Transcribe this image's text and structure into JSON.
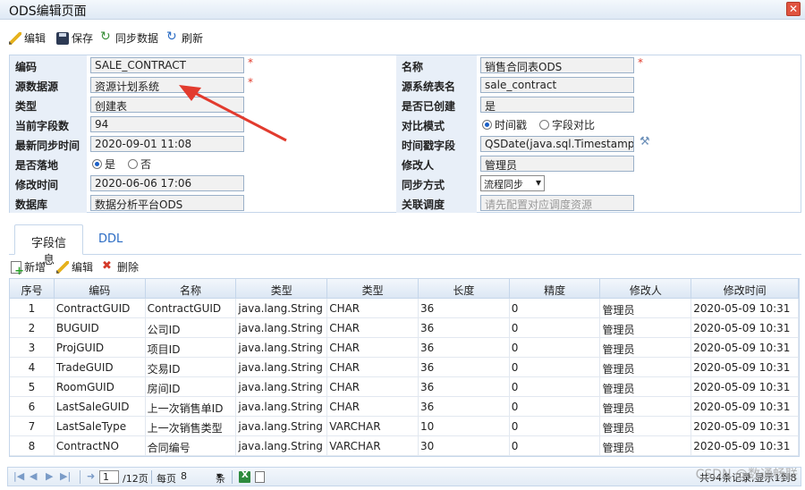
{
  "window": {
    "title": "ODS编辑页面",
    "close_glyph": "✕"
  },
  "toolbar": {
    "edit": "编辑",
    "save": "保存",
    "sync": "同步数据",
    "refresh": "刷新"
  },
  "form": {
    "code_label": "编码",
    "code_value": "SALE_CONTRACT",
    "name_label": "名称",
    "name_value": "销售合同表ODS",
    "source_label": "源数据源",
    "source_value": "资源计划系统",
    "source_table_label": "源系统表名",
    "source_table_value": "sale_contract",
    "type_label": "类型",
    "type_value": "创建表",
    "created_label": "是否已创建",
    "created_value": "是",
    "field_count_label": "当前字段数",
    "field_count_value": "94",
    "compare_label": "对比模式",
    "compare_opt1": "时间戳",
    "compare_opt2": "字段对比",
    "last_sync_label": "最新同步时间",
    "last_sync_value": "2020-09-01 11:08",
    "ts_field_label": "时间戳字段",
    "ts_field_value": "QSDate(java.sql.Timestamp)",
    "landed_label": "是否落地",
    "landed_yes": "是",
    "landed_no": "否",
    "modifier_label": "修改人",
    "modifier_value": "管理员",
    "mtime_label": "修改时间",
    "mtime_value": "2020-06-06 17:06",
    "sync_mode_label": "同步方式",
    "sync_mode_value": "流程同步",
    "db_label": "数据库",
    "db_value": "数据分析平台ODS",
    "schedule_label": "关联调度",
    "schedule_placeholder": "请先配置对应调度资源",
    "required_mark": "*"
  },
  "tabs": {
    "fields": "字段信息",
    "ddl": "DDL"
  },
  "grid_toolbar": {
    "add": "新增",
    "edit": "编辑",
    "delete": "删除"
  },
  "grid": {
    "headers": [
      "序号",
      "编码",
      "名称",
      "类型",
      "类型",
      "长度",
      "精度",
      "修改人",
      "修改时间"
    ],
    "rows": [
      [
        "1",
        "ContractGUID",
        "ContractGUID",
        "java.lang.String",
        "CHAR",
        "36",
        "0",
        "管理员",
        "2020-05-09 10:31"
      ],
      [
        "2",
        "BUGUID",
        "公司ID",
        "java.lang.String",
        "CHAR",
        "36",
        "0",
        "管理员",
        "2020-05-09 10:31"
      ],
      [
        "3",
        "ProjGUID",
        "项目ID",
        "java.lang.String",
        "CHAR",
        "36",
        "0",
        "管理员",
        "2020-05-09 10:31"
      ],
      [
        "4",
        "TradeGUID",
        "交易ID",
        "java.lang.String",
        "CHAR",
        "36",
        "0",
        "管理员",
        "2020-05-09 10:31"
      ],
      [
        "5",
        "RoomGUID",
        "房间ID",
        "java.lang.String",
        "CHAR",
        "36",
        "0",
        "管理员",
        "2020-05-09 10:31"
      ],
      [
        "6",
        "LastSaleGUID",
        "上一次销售单ID",
        "java.lang.String",
        "CHAR",
        "36",
        "0",
        "管理员",
        "2020-05-09 10:31"
      ],
      [
        "7",
        "LastSaleType",
        "上一次销售类型",
        "java.lang.String",
        "VARCHAR",
        "10",
        "0",
        "管理员",
        "2020-05-09 10:31"
      ],
      [
        "8",
        "ContractNO",
        "合同编号",
        "java.lang.String",
        "VARCHAR",
        "30",
        "0",
        "管理员",
        "2020-05-09 10:31"
      ]
    ]
  },
  "pager": {
    "page_value": "1",
    "total_pages": "/12页",
    "per_page_label": "每页",
    "per_page_value": "8",
    "unit": "条",
    "summary": "共94条记录,显示1到8"
  },
  "watermark": "CSDN @数通畅联"
}
